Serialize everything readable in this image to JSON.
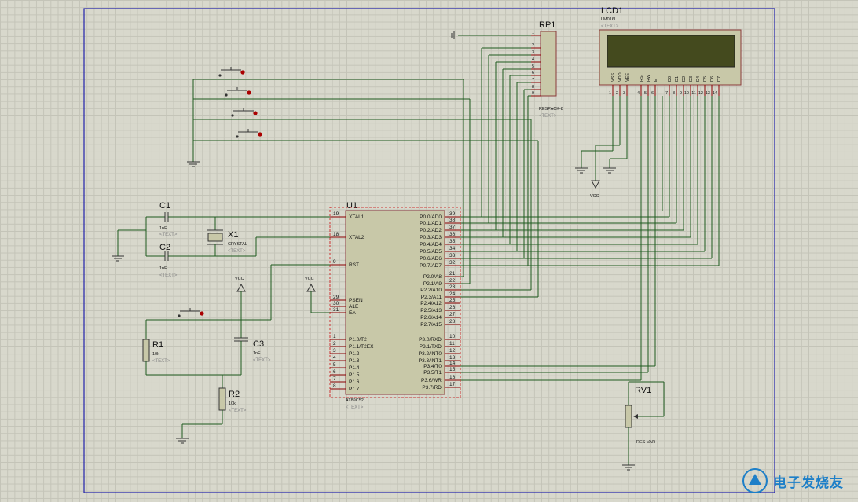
{
  "components": {
    "rp1": {
      "ref": "RP1",
      "value": "RESPACK-8",
      "text": "<TEXT>",
      "pins": [
        "1",
        "2",
        "3",
        "4",
        "5",
        "6",
        "7",
        "8",
        "9"
      ]
    },
    "lcd1": {
      "ref": "LCD1",
      "model": "LM016L",
      "text": "<TEXT>",
      "pin_names": [
        "VSS",
        "VDD",
        "VEE",
        "RS",
        "RW",
        "E",
        "D0",
        "D1",
        "D2",
        "D3",
        "D4",
        "D5",
        "D6",
        "D7"
      ],
      "pin_nums": [
        "1",
        "2",
        "3",
        "4",
        "5",
        "6",
        "7",
        "8",
        "9",
        "10",
        "11",
        "12",
        "13",
        "14"
      ]
    },
    "u1": {
      "ref": "U1",
      "model": "AT89C52",
      "text": "<TEXT>",
      "left_pins": [
        {
          "num": "19",
          "name": "XTAL1"
        },
        {
          "num": "18",
          "name": "XTAL2"
        },
        {
          "num": "9",
          "name": "RST"
        },
        {
          "num": "29",
          "name": "PSEN"
        },
        {
          "num": "30",
          "name": "ALE"
        },
        {
          "num": "31",
          "name": "EA"
        },
        {
          "num": "1",
          "name": "P1.0/T2"
        },
        {
          "num": "2",
          "name": "P1.1/T2EX"
        },
        {
          "num": "3",
          "name": "P1.2"
        },
        {
          "num": "4",
          "name": "P1.3"
        },
        {
          "num": "5",
          "name": "P1.4"
        },
        {
          "num": "6",
          "name": "P1.5"
        },
        {
          "num": "7",
          "name": "P1.6"
        },
        {
          "num": "8",
          "name": "P1.7"
        }
      ],
      "right_pins": [
        {
          "num": "39",
          "name": "P0.0/AD0"
        },
        {
          "num": "38",
          "name": "P0.1/AD1"
        },
        {
          "num": "37",
          "name": "P0.2/AD2"
        },
        {
          "num": "36",
          "name": "P0.3/AD3"
        },
        {
          "num": "35",
          "name": "P0.4/AD4"
        },
        {
          "num": "34",
          "name": "P0.5/AD5"
        },
        {
          "num": "33",
          "name": "P0.6/AD6"
        },
        {
          "num": "32",
          "name": "P0.7/AD7"
        },
        {
          "num": "21",
          "name": "P2.0/A8"
        },
        {
          "num": "22",
          "name": "P2.1/A9"
        },
        {
          "num": "23",
          "name": "P2.2/A10"
        },
        {
          "num": "24",
          "name": "P2.3/A11"
        },
        {
          "num": "25",
          "name": "P2.4/A12"
        },
        {
          "num": "26",
          "name": "P2.5/A13"
        },
        {
          "num": "27",
          "name": "P2.6/A14"
        },
        {
          "num": "28",
          "name": "P2.7/A15"
        },
        {
          "num": "10",
          "name": "P3.0/RXD"
        },
        {
          "num": "11",
          "name": "P3.1/TXD"
        },
        {
          "num": "12",
          "name": "P3.2/INT0"
        },
        {
          "num": "13",
          "name": "P3.3/INT1"
        },
        {
          "num": "14",
          "name": "P3.4/T0"
        },
        {
          "num": "15",
          "name": "P3.5/T1"
        },
        {
          "num": "16",
          "name": "P3.6/WR"
        },
        {
          "num": "17",
          "name": "P3.7/RD"
        }
      ]
    },
    "c1": {
      "ref": "C1",
      "value": "1nF",
      "text": "<TEXT>"
    },
    "c2": {
      "ref": "C2",
      "value": "1nF",
      "text": "<TEXT>"
    },
    "c3": {
      "ref": "C3",
      "value": "1nF",
      "text": "<TEXT>"
    },
    "x1": {
      "ref": "X1",
      "value": "CRYSTAL",
      "text": "<TEXT>"
    },
    "r1": {
      "ref": "R1",
      "value": "10k",
      "text": "<TEXT>"
    },
    "r2": {
      "ref": "R2",
      "value": "10k",
      "text": "<TEXT>"
    },
    "rv1": {
      "ref": "RV1",
      "value": "RES-VAR"
    }
  },
  "power": {
    "vcc_label": "VCC"
  },
  "watermark": {
    "text": "电子发烧友"
  }
}
